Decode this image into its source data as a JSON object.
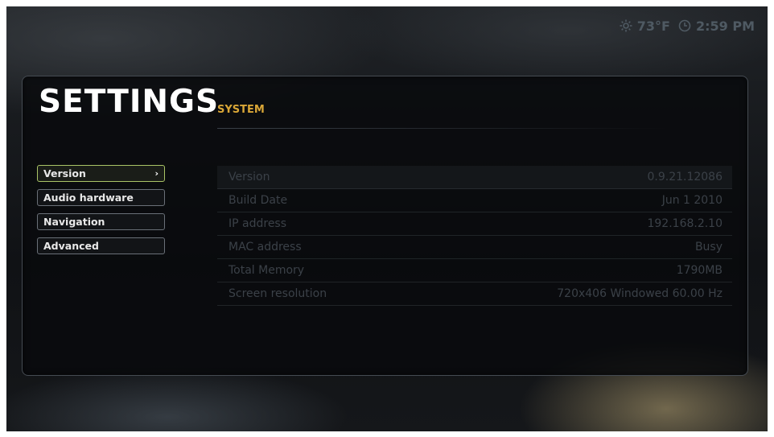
{
  "status": {
    "weather_icon": "sun-icon",
    "temperature": "73°F",
    "clock_icon": "clock-icon",
    "time": "2:59 PM"
  },
  "header": {
    "title": "SETTINGS",
    "subtitle": "SYSTEM"
  },
  "menu": {
    "items": [
      {
        "label": "Version",
        "selected": true
      },
      {
        "label": "Audio hardware"
      },
      {
        "label": "Navigation"
      },
      {
        "label": "Advanced"
      }
    ]
  },
  "info": {
    "rows": [
      {
        "label": "Version",
        "value": "0.9.21.12086"
      },
      {
        "label": "Build Date",
        "value": "Jun 1 2010"
      },
      {
        "label": "IP address",
        "value": "192.168.2.10"
      },
      {
        "label": "MAC address",
        "value": "Busy"
      },
      {
        "label": "Total Memory",
        "value": "1790MB"
      },
      {
        "label": "Screen resolution",
        "value": "720x406 Windowed 60.00 Hz"
      }
    ]
  },
  "colors": {
    "accent": "#d9a637",
    "selection_border": "#a9c466"
  }
}
